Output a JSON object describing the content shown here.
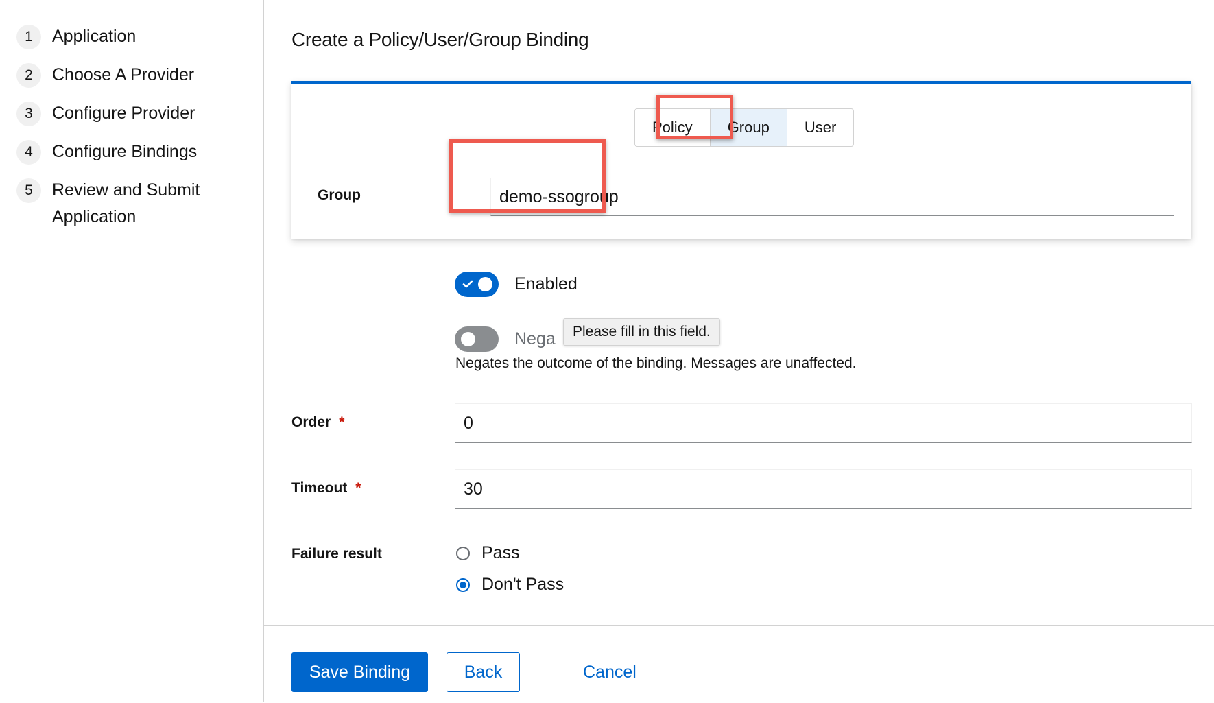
{
  "wizard": {
    "steps": [
      {
        "num": "1",
        "label": "Application"
      },
      {
        "num": "2",
        "label": "Choose A Provider"
      },
      {
        "num": "3",
        "label": "Configure Provider"
      },
      {
        "num": "4",
        "label": "Configure Bindings"
      },
      {
        "num": "5",
        "label": "Review and Submit Application"
      }
    ]
  },
  "page": {
    "title": "Create a Policy/User/Group Binding"
  },
  "binding_type": {
    "options": [
      "Policy",
      "Group",
      "User"
    ],
    "selected": "Group"
  },
  "group_field": {
    "label": "Group",
    "value": "demo-ssogroup"
  },
  "enabled_switch": {
    "label": "Enabled",
    "on": true
  },
  "negate_switch": {
    "label_visible": "Nega",
    "on": false,
    "helper": "Negates the outcome of the binding. Messages are unaffected."
  },
  "tooltip": {
    "text": "Please fill in this field."
  },
  "order_field": {
    "label": "Order",
    "required_mark": "*",
    "value": "0"
  },
  "timeout_field": {
    "label": "Timeout",
    "required_mark": "*",
    "value": "30"
  },
  "failure_result": {
    "label": "Failure result",
    "options": [
      "Pass",
      "Don't Pass"
    ],
    "selected": "Don't Pass"
  },
  "footer": {
    "save_label": "Save Binding",
    "back_label": "Back",
    "cancel_label": "Cancel"
  },
  "colors": {
    "accent": "#0066cc",
    "annotation": "#ee5a4f",
    "required": "#c9190b"
  }
}
